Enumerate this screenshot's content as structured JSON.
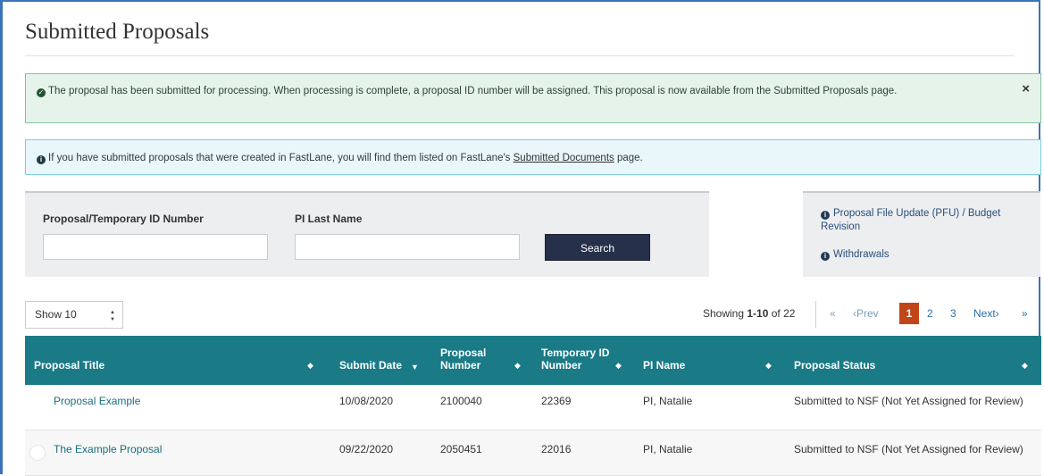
{
  "page": {
    "title": "Submitted Proposals"
  },
  "alerts": {
    "success": {
      "text": "The proposal has been submitted for processing. When processing is complete, a proposal ID number will be assigned. This proposal is now available from the Submitted Proposals page.",
      "close": "×",
      "icon": "check-circle-icon"
    },
    "info": {
      "text_before": "If you have submitted proposals that were created in FastLane, you will find them listed on FastLane's",
      "link": "Submitted Documents",
      "text_after": "page.",
      "icon": "info-circle-icon"
    }
  },
  "search": {
    "id_label": "Proposal/Temporary ID Number",
    "id_value": "",
    "pi_label": "PI Last Name",
    "pi_value": "",
    "button": "Search"
  },
  "side_links": [
    {
      "label": "Proposal File Update (PFU) / Budget Revision",
      "icon": "info-circle-icon"
    },
    {
      "label": "Withdrawals",
      "icon": "info-circle-icon"
    }
  ],
  "list_controls": {
    "show_select": "Show 10",
    "showing_prefix": "Showing ",
    "showing_range": "1-10",
    "showing_suffix": " of 22",
    "first": "«",
    "prev": "‹Prev",
    "pages": [
      "1",
      "2",
      "3"
    ],
    "current_page": "1",
    "next": "Next›",
    "last": "»"
  },
  "table": {
    "columns": [
      {
        "label": "Proposal Title"
      },
      {
        "label": "Submit Date"
      },
      {
        "label": "Proposal Number"
      },
      {
        "label": "Temporary ID Number"
      },
      {
        "label": "PI Name"
      },
      {
        "label": "Proposal Status"
      }
    ],
    "rows": [
      {
        "title": "Proposal Example",
        "submit_date": "10/08/2020",
        "proposal_number": "2100040",
        "temp_id": "22369",
        "pi_name": "PI, Natalie",
        "status": "Submitted to NSF (Not Yet Assigned for Review)"
      },
      {
        "title": "The Example Proposal",
        "submit_date": "09/22/2020",
        "proposal_number": "2050451",
        "temp_id": "22016",
        "pi_name": "PI, Natalie",
        "status": "Submitted to NSF (Not Yet Assigned for Review)"
      }
    ]
  },
  "colors": {
    "header_teal": "#1a7a86",
    "success_bg": "#e5f3ea",
    "info_bg": "#e9f6fa",
    "search_button": "#27304a",
    "current_page": "#c0461a"
  }
}
